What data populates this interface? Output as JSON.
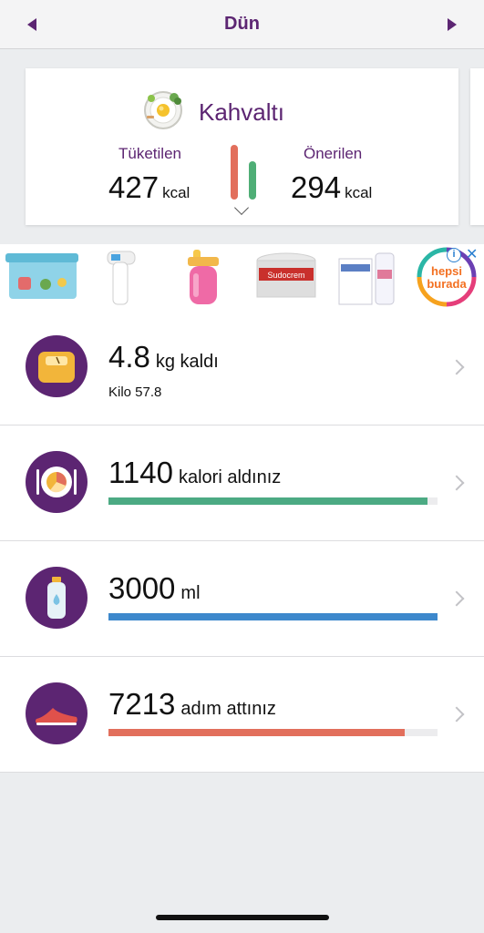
{
  "header": {
    "title": "Dün"
  },
  "meal": {
    "name": "Kahvaltı",
    "consumed_label": "Tüketilen",
    "consumed_value": "427",
    "consumed_unit": "kcal",
    "recommended_label": "Önerilen",
    "recommended_value": "294",
    "recommended_unit": "kcal",
    "colors": {
      "consumed": "#e26f5c",
      "recommended": "#4fae76"
    }
  },
  "ad": {
    "brand_line1": "hepsi",
    "brand_line2": "burada",
    "info_icon": "i",
    "close_icon": "✕",
    "product_label": "Sudocrem"
  },
  "rows": [
    {
      "value": "4.8",
      "label": "kg kaldı",
      "sub": "Kilo 57.8",
      "icon": "scale-icon"
    },
    {
      "value": "1140",
      "label": "kalori aldınız",
      "progress": 0.97,
      "color": "#4caa83",
      "icon": "plate-icon"
    },
    {
      "value": "3000",
      "label": "ml",
      "progress": 1.0,
      "color": "#3d88cc",
      "icon": "water-bottle-icon"
    },
    {
      "value": "7213",
      "label": "adım attınız",
      "progress": 0.9,
      "color": "#e26f5c",
      "icon": "shoe-icon"
    }
  ]
}
